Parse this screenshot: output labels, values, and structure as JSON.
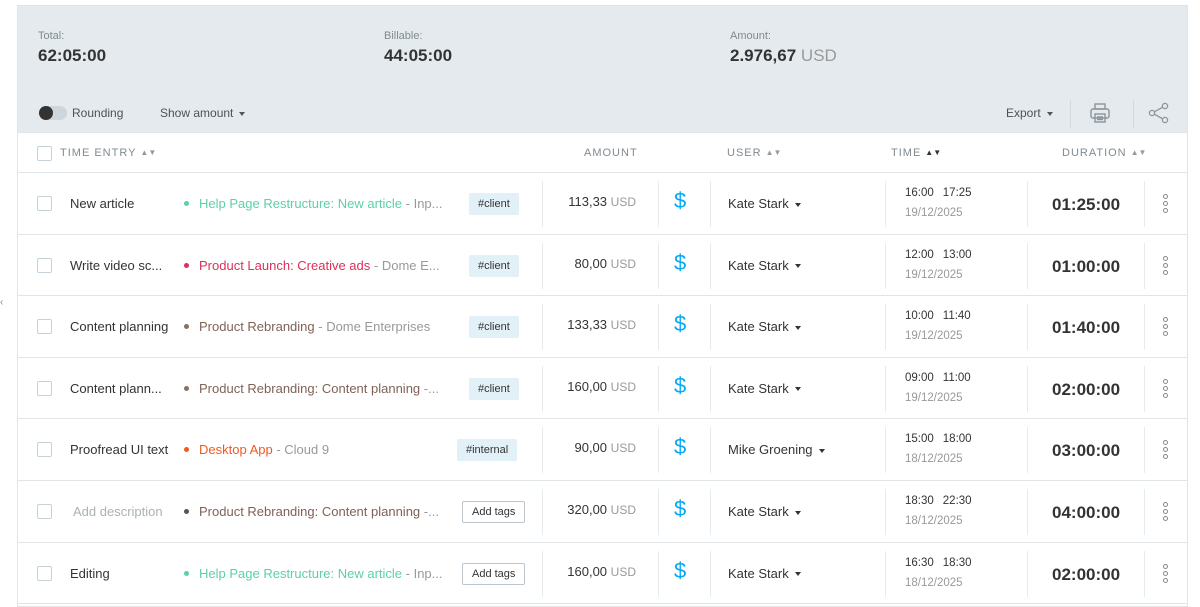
{
  "summary": {
    "total_label": "Total:",
    "total_value": "62:05:00",
    "billable_label": "Billable:",
    "billable_value": "44:05:00",
    "amount_label": "Amount:",
    "amount_value": "2.976,67",
    "amount_unit": "USD"
  },
  "toolbar": {
    "rounding_label": "Rounding",
    "show_amount_label": "Show amount",
    "export_label": "Export",
    "print_icon": "printer-icon",
    "share_icon": "share-icon"
  },
  "columns": {
    "time_entry": "TIME ENTRY",
    "amount": "AMOUNT",
    "user": "USER",
    "time": "TIME",
    "duration": "DURATION"
  },
  "colors": {
    "billable_dollar": "#03a9f4",
    "tag_bg": "#e2f0f8",
    "toolbar_bg": "#e4eaee"
  },
  "entries": [
    {
      "description": "New article",
      "description_placeholder": false,
      "project": "Help Page Restructure: New article",
      "client": " - Inp...",
      "project_color": "#5dcfa9",
      "dot_color": "#5dcfa9",
      "tag": "#client",
      "amount": "113,33",
      "unit": "USD",
      "user": "Kate Stark",
      "start": "16:00",
      "end": "17:25",
      "date": "19/12/2025",
      "duration": "01:25:00"
    },
    {
      "description": "Write video sc...",
      "description_placeholder": false,
      "project": "Product Launch: Creative ads",
      "client": " - Dome E...",
      "project_color": "#dd2f58",
      "dot_color": "#dd2f58",
      "tag": "#client",
      "amount": "80,00",
      "unit": "USD",
      "user": "Kate Stark",
      "start": "12:00",
      "end": "13:00",
      "date": "19/12/2025",
      "duration": "01:00:00"
    },
    {
      "description": "Content planning",
      "description_placeholder": false,
      "project": "Product Rebranding",
      "client": " - Dome Enterprises",
      "project_color": "#7f6257",
      "dot_color": "#8d6e63",
      "tag": "#client",
      "amount": "133,33",
      "unit": "USD",
      "user": "Kate Stark",
      "start": "10:00",
      "end": "11:40",
      "date": "19/12/2025",
      "duration": "01:40:00"
    },
    {
      "description": "Content plann...",
      "description_placeholder": false,
      "project": "Product Rebranding: Content planning",
      "client": " -...",
      "project_color": "#7f6257",
      "dot_color": "#8d6e63",
      "tag": "#client",
      "amount": "160,00",
      "unit": "USD",
      "user": "Kate Stark",
      "start": "09:00",
      "end": "11:00",
      "date": "19/12/2025",
      "duration": "02:00:00"
    },
    {
      "description": "Proofread UI text",
      "description_placeholder": false,
      "project": "Desktop App",
      "client": " - Cloud 9",
      "project_color": "#f4581f",
      "dot_color": "#f4581f",
      "tag": "#internal",
      "amount": "90,00",
      "unit": "USD",
      "user": "Mike Groening",
      "start": "15:00",
      "end": "18:00",
      "date": "18/12/2025",
      "duration": "03:00:00"
    },
    {
      "description": "Add description",
      "description_placeholder": true,
      "project": "Product Rebranding: Content planning",
      "client": " -...",
      "project_color": "#7f6257",
      "dot_color": "#555555",
      "tag": "Add tags",
      "tag_empty": true,
      "amount": "320,00",
      "unit": "USD",
      "user": "Kate Stark",
      "start": "18:30",
      "end": "22:30",
      "date": "18/12/2025",
      "duration": "04:00:00"
    },
    {
      "description": "Editing",
      "description_placeholder": false,
      "project": "Help Page Restructure: New article",
      "client": " - Inp...",
      "project_color": "#5dcfa9",
      "dot_color": "#5dcfa9",
      "tag": "Add tags",
      "tag_empty": true,
      "amount": "160,00",
      "unit": "USD",
      "user": "Kate Stark",
      "start": "16:30",
      "end": "18:30",
      "date": "18/12/2025",
      "duration": "02:00:00"
    }
  ]
}
